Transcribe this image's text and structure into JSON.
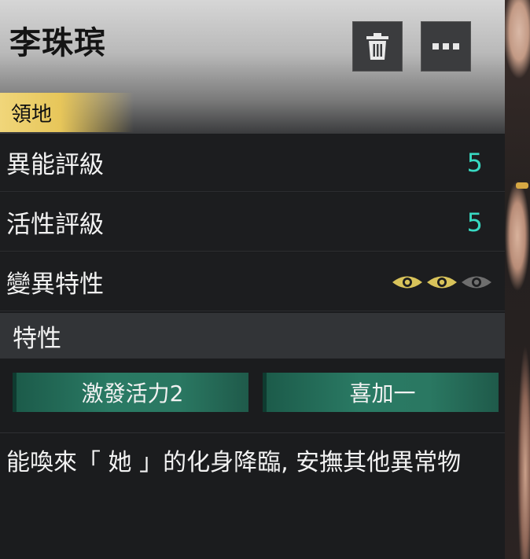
{
  "header": {
    "name": "李珠瑸",
    "tag": "領地",
    "delete_icon": "trash-icon",
    "more_icon": "more-dots-icon"
  },
  "stats": [
    {
      "label": "異能評級",
      "value": "5"
    },
    {
      "label": "活性評級",
      "value": "5"
    }
  ],
  "mutation": {
    "label": "變異特性",
    "level": 2,
    "max_level": 3,
    "active_color": "#d8c35a",
    "inactive_color": "#6e6e6e"
  },
  "traits": {
    "title": "特性",
    "items": [
      {
        "label": "激發活力2"
      },
      {
        "label": "喜加一"
      }
    ]
  },
  "description": "能喚來「 她 」的化身降臨, 安撫其他異常物",
  "colors": {
    "value_accent": "#38d9c2",
    "trait_button": "#2a7a64",
    "tag_gold": "#e7c65a"
  }
}
